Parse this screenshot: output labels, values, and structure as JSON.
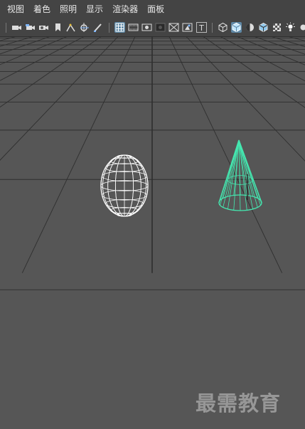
{
  "menubar": {
    "items": [
      {
        "label": "视图"
      },
      {
        "label": "着色"
      },
      {
        "label": "照明"
      },
      {
        "label": "显示"
      },
      {
        "label": "渲染器"
      },
      {
        "label": "面板"
      }
    ]
  },
  "toolbar": {
    "icons": [
      "camera-select-icon",
      "camera-attributes-icon",
      "bookmark-icon",
      "image-plane-icon",
      "2d-pan-zoom-icon",
      "grease-pencil-icon",
      "grid-icon",
      "film-gate-icon",
      "resolution-gate-icon",
      "gate-mask-icon",
      "field-chart-icon",
      "safe-action-icon",
      "safe-title-icon",
      "wireframe-icon",
      "smooth-shade-icon",
      "default-material-icon",
      "wireframe-on-shaded-icon",
      "textured-icon",
      "lighting-icon"
    ]
  },
  "viewport": {
    "background": "#565656",
    "grid_color": "#2f2f2f",
    "objects": [
      {
        "name": "sphere",
        "display": "wireframe",
        "color": "#ffffff",
        "selected": false
      },
      {
        "name": "cone",
        "display": "wireframe",
        "color": "#44e8b0",
        "selected": true
      }
    ]
  },
  "watermark": {
    "text": "最需教育"
  }
}
